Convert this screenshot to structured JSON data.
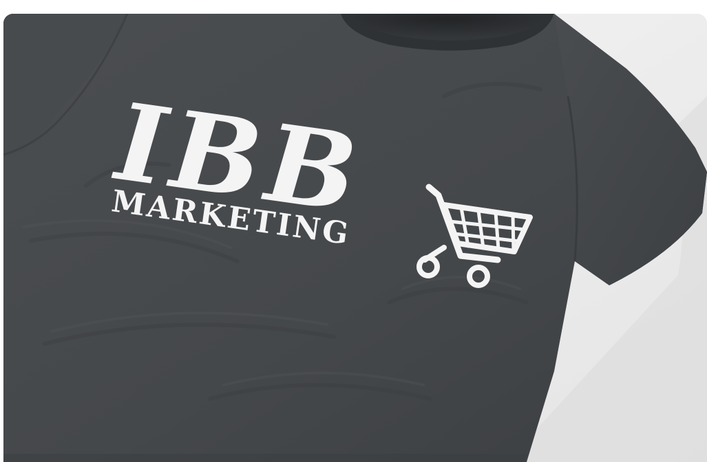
{
  "photo": {
    "subject": "t-shirt",
    "shirt_color": "#45484b",
    "collar_color": "#2e3032",
    "background_color": "#efefef",
    "print_color": "#f4f4f4"
  },
  "logo": {
    "main_text": "IBB",
    "sub_text": "MARKETING",
    "icon": "shopping-cart-icon"
  }
}
